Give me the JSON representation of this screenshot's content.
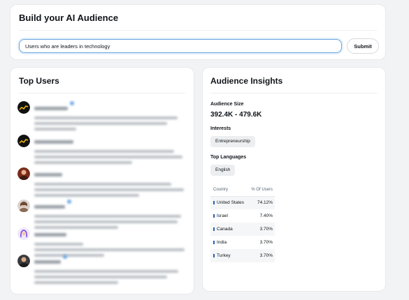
{
  "builder": {
    "title": "Build your AI Audience",
    "query_value": "Users who are leaders in technology",
    "submit_label": "Submit"
  },
  "top_users": {
    "title": "Top Users",
    "users": [
      {
        "avatar_icon": "chart-avatar-icon"
      },
      {
        "avatar_icon": "chart-avatar-icon"
      },
      {
        "avatar_icon": "person-avatar-icon"
      },
      {
        "avatar_icon": "person-avatar-icon"
      },
      {
        "avatar_icon": "illustration-avatar-icon"
      },
      {
        "avatar_icon": "person-avatar-icon"
      }
    ]
  },
  "insights": {
    "title": "Audience Insights",
    "size_label": "Audience Size",
    "size_value": "392.4K - 479.6K",
    "interests_label": "Interests",
    "interests": [
      "Entrepreneurship"
    ],
    "languages_label": "Top Languages",
    "languages": [
      "English"
    ],
    "table": {
      "headers": [
        "Country",
        "% Of Users"
      ],
      "rows": [
        {
          "country": "United States",
          "pct": "74.12%"
        },
        {
          "country": "Israel",
          "pct": "7.40%"
        },
        {
          "country": "Canada",
          "pct": "3.70%"
        },
        {
          "country": "India",
          "pct": "3.70%"
        },
        {
          "country": "Turkey",
          "pct": "3.70%"
        }
      ]
    }
  },
  "colors": {
    "accent_border": "#6aa7e0",
    "verified_badge": "#6aa9e6",
    "flag_marker": "#1d5fb8"
  }
}
